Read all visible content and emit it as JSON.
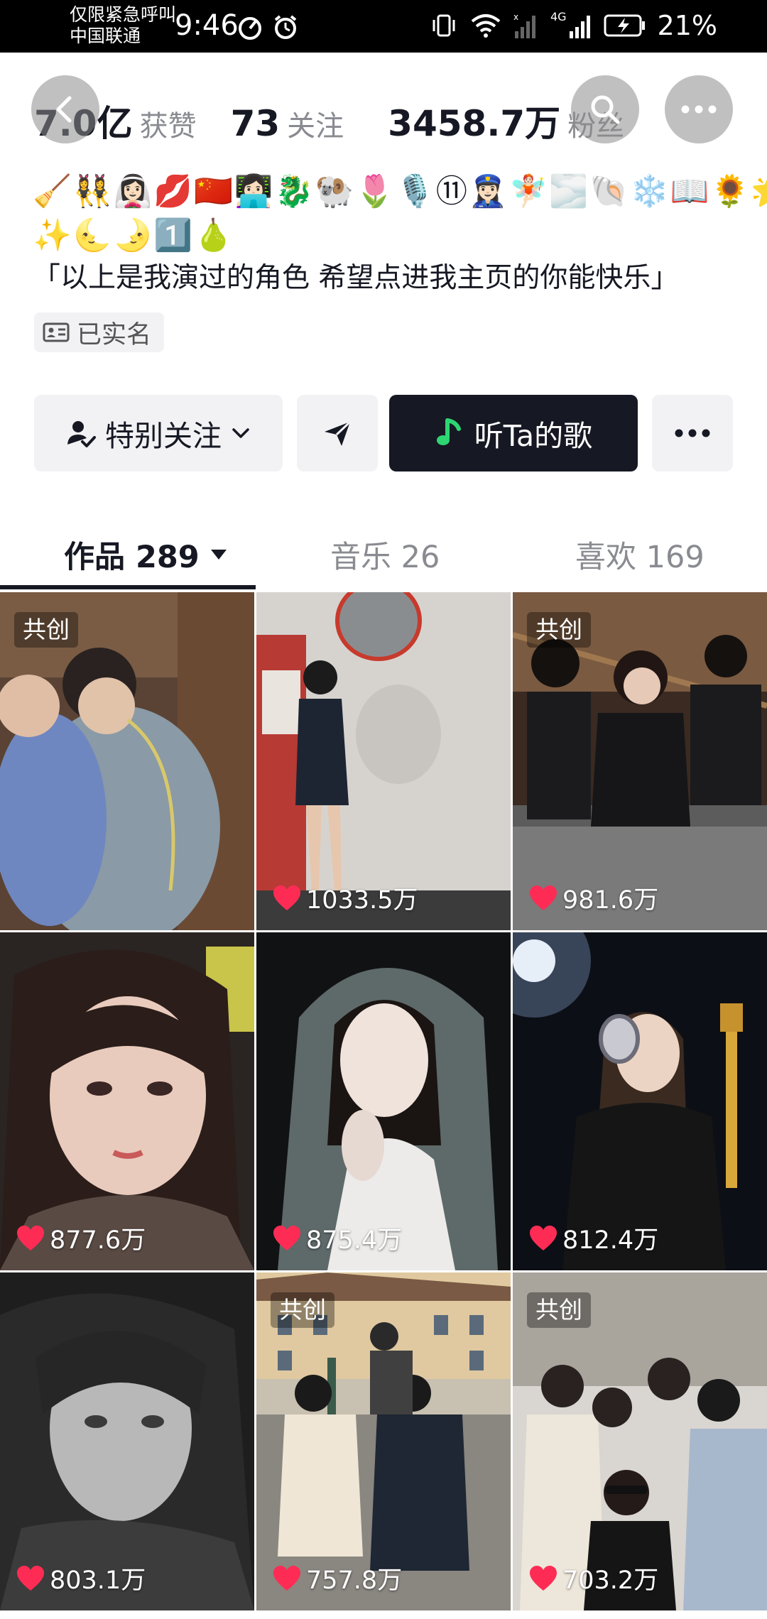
{
  "status_bar": {
    "carrier_line1": "仅限紧急呼叫",
    "carrier_line2": "中国联通",
    "time": "9:46",
    "network": "4G",
    "battery": "21%"
  },
  "profile": {
    "stats": {
      "likes_value": "7.0亿",
      "likes_label": "获赞",
      "following_value": "73",
      "following_label": "关注",
      "followers_value": "3458.7万",
      "followers_label": "粉丝"
    },
    "emoji_line1": "🧹👯‍♀️👰🏻‍♀️💋🇨🇳👩🏻‍💻🐉🐏🌷🎙️⑪👮🏻‍♀️🧚🏻🌫️🐚❄️📖🌻🌟",
    "emoji_line2": "✨🌜🌛1️⃣🍐",
    "bio": "「以上是我演过的角色 希望点进我主页的你能快乐」",
    "verified_label": "已实名"
  },
  "actions": {
    "special_follow_label": "特别关注",
    "listen_label": "听Ta的歌"
  },
  "tabs": {
    "works": "作品 289",
    "music": "音乐 26",
    "likes": "喜欢 169"
  },
  "videos": [
    {
      "badge": "共创",
      "likes": ""
    },
    {
      "badge": "",
      "likes": "1033.5万"
    },
    {
      "badge": "共创",
      "likes": "981.6万"
    },
    {
      "badge": "",
      "likes": "877.6万"
    },
    {
      "badge": "",
      "likes": "875.4万"
    },
    {
      "badge": "",
      "likes": "812.4万"
    },
    {
      "badge": "",
      "likes": "803.1万"
    },
    {
      "badge": "共创",
      "likes": "757.8万"
    },
    {
      "badge": "共创",
      "likes": "703.2万"
    }
  ],
  "colors": {
    "primary_text": "#161823",
    "secondary_text": "#8a8b91",
    "button_bg": "#f2f2f4",
    "dark_button": "#161823",
    "heart": "#fe2c55"
  }
}
